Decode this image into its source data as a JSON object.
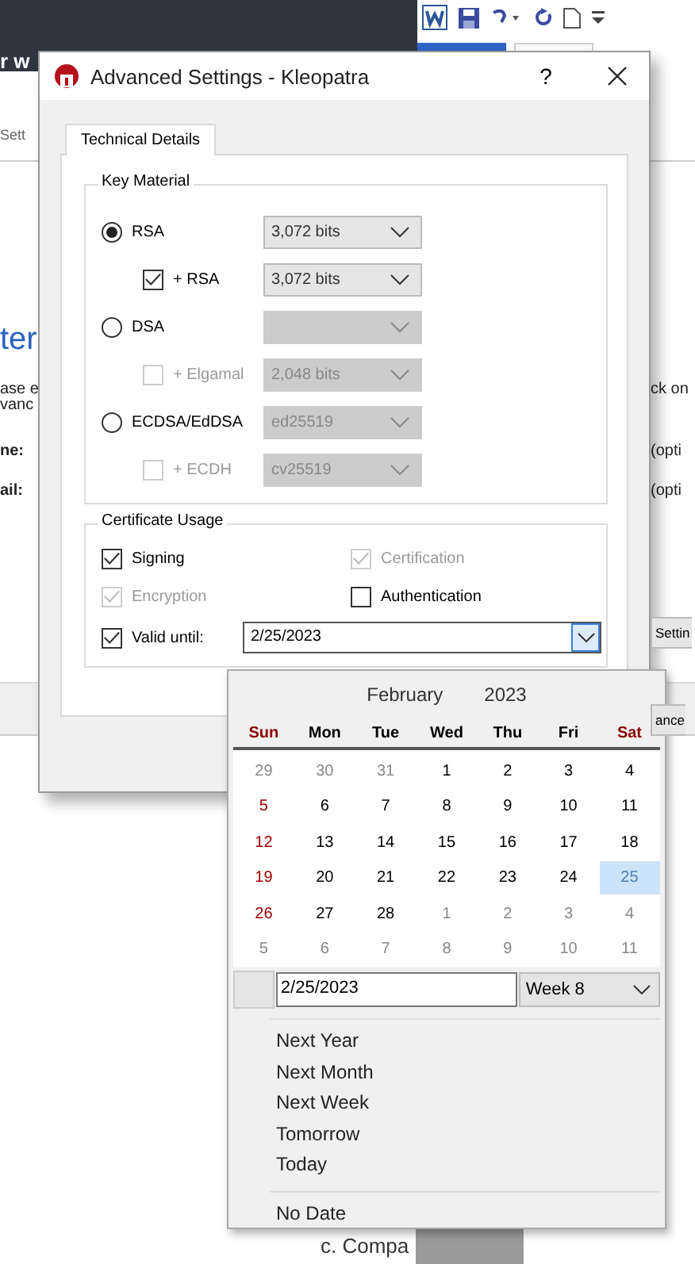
{
  "background": {
    "top_text": "r w",
    "left_fragments": [
      {
        "text": "Sett",
        "kind": "tab"
      },
      {
        "text": "ter",
        "kind": "heading"
      },
      {
        "text": "ase e",
        "kind": "text"
      },
      {
        "text": "vanc",
        "kind": "text"
      },
      {
        "text": "ne:",
        "kind": "label"
      },
      {
        "text": "ail:",
        "kind": "label"
      }
    ],
    "right_fragments": [
      {
        "text": "ck on",
        "kind": "text"
      },
      {
        "text": "(opti",
        "kind": "text"
      },
      {
        "text": "(opti",
        "kind": "text"
      },
      {
        "text": "Settin",
        "kind": "button"
      },
      {
        "text": "ance",
        "kind": "button"
      }
    ],
    "footer_text": "c. Compa"
  },
  "dialog": {
    "title": "Advanced Settings - Kleopatra",
    "help": "?"
  },
  "tabs": [
    {
      "label": "Technical Details",
      "selected": true
    }
  ],
  "key_material": {
    "title": "Key Material",
    "rows": [
      {
        "kind": "radio",
        "label": "RSA",
        "selected": true,
        "disabled": false,
        "combo_disabled": false,
        "value": "3,072 bits"
      },
      {
        "kind": "checkbox",
        "label": "+ RSA",
        "checked": true,
        "disabled": false,
        "combo_disabled": false,
        "value": "3,072 bits"
      },
      {
        "kind": "radio",
        "label": "DSA",
        "selected": false,
        "disabled": false,
        "combo_disabled": true
      },
      {
        "kind": "checkbox",
        "label": "+ Elgamal",
        "checked": false,
        "disabled": true,
        "combo_disabled": true,
        "value": "2,048 bits"
      },
      {
        "kind": "radio",
        "label": "ECDSA/EdDSA",
        "selected": false,
        "disabled": false,
        "combo_disabled": true,
        "value": "ed25519"
      },
      {
        "kind": "checkbox",
        "label": "+ ECDH",
        "checked": false,
        "disabled": true,
        "combo_disabled": true,
        "value": "cv25519"
      }
    ]
  },
  "certificate_usage": {
    "title": "Certificate Usage",
    "options": [
      {
        "label": "Signing",
        "checked": true,
        "disabled": false
      },
      {
        "label": "Certification",
        "checked": true,
        "disabled": true
      },
      {
        "label": "Encryption",
        "checked": true,
        "disabled": true
      },
      {
        "label": "Authentication",
        "checked": false,
        "disabled": false
      }
    ],
    "valid_until": {
      "label": "Valid until:",
      "checked": true,
      "value": "2/25/2023"
    }
  },
  "calendar": {
    "month": "February",
    "year": "2023",
    "weekdays": [
      {
        "label": "Sun",
        "red": true
      },
      {
        "label": "Mon",
        "red": false
      },
      {
        "label": "Tue",
        "red": false
      },
      {
        "label": "Wed",
        "red": false
      },
      {
        "label": "Thu",
        "red": false
      },
      {
        "label": "Fri",
        "red": false
      },
      {
        "label": "Sat",
        "red": true
      }
    ],
    "weeks": [
      [
        {
          "d": "29",
          "muted": true,
          "red": false,
          "selected": false
        },
        {
          "d": "30",
          "muted": true,
          "red": false,
          "selected": false
        },
        {
          "d": "31",
          "muted": true,
          "red": false,
          "selected": false
        },
        {
          "d": "1",
          "muted": false,
          "red": false,
          "selected": false
        },
        {
          "d": "2",
          "muted": false,
          "red": false,
          "selected": false
        },
        {
          "d": "3",
          "muted": false,
          "red": false,
          "selected": false
        },
        {
          "d": "4",
          "muted": false,
          "red": false,
          "selected": false
        }
      ],
      [
        {
          "d": "5",
          "muted": false,
          "red": true,
          "selected": false
        },
        {
          "d": "6",
          "muted": false,
          "red": false,
          "selected": false
        },
        {
          "d": "7",
          "muted": false,
          "red": false,
          "selected": false
        },
        {
          "d": "8",
          "muted": false,
          "red": false,
          "selected": false
        },
        {
          "d": "9",
          "muted": false,
          "red": false,
          "selected": false
        },
        {
          "d": "10",
          "muted": false,
          "red": false,
          "selected": false
        },
        {
          "d": "11",
          "muted": false,
          "red": false,
          "selected": false
        }
      ],
      [
        {
          "d": "12",
          "muted": false,
          "red": true,
          "selected": false
        },
        {
          "d": "13",
          "muted": false,
          "red": false,
          "selected": false
        },
        {
          "d": "14",
          "muted": false,
          "red": false,
          "selected": false
        },
        {
          "d": "15",
          "muted": false,
          "red": false,
          "selected": false
        },
        {
          "d": "16",
          "muted": false,
          "red": false,
          "selected": false
        },
        {
          "d": "17",
          "muted": false,
          "red": false,
          "selected": false
        },
        {
          "d": "18",
          "muted": false,
          "red": false,
          "selected": false
        }
      ],
      [
        {
          "d": "19",
          "muted": false,
          "red": true,
          "selected": false
        },
        {
          "d": "20",
          "muted": false,
          "red": false,
          "selected": false
        },
        {
          "d": "21",
          "muted": false,
          "red": false,
          "selected": false
        },
        {
          "d": "22",
          "muted": false,
          "red": false,
          "selected": false
        },
        {
          "d": "23",
          "muted": false,
          "red": false,
          "selected": false
        },
        {
          "d": "24",
          "muted": false,
          "red": false,
          "selected": false
        },
        {
          "d": "25",
          "muted": false,
          "red": false,
          "selected": true
        }
      ],
      [
        {
          "d": "26",
          "muted": false,
          "red": true,
          "selected": false
        },
        {
          "d": "27",
          "muted": false,
          "red": false,
          "selected": false
        },
        {
          "d": "28",
          "muted": false,
          "red": false,
          "selected": false
        },
        {
          "d": "1",
          "muted": true,
          "red": false,
          "selected": false
        },
        {
          "d": "2",
          "muted": true,
          "red": false,
          "selected": false
        },
        {
          "d": "3",
          "muted": true,
          "red": false,
          "selected": false
        },
        {
          "d": "4",
          "muted": true,
          "red": false,
          "selected": false
        }
      ],
      [
        {
          "d": "5",
          "muted": true,
          "red": false,
          "selected": false
        },
        {
          "d": "6",
          "muted": true,
          "red": false,
          "selected": false
        },
        {
          "d": "7",
          "muted": true,
          "red": false,
          "selected": false
        },
        {
          "d": "8",
          "muted": true,
          "red": false,
          "selected": false
        },
        {
          "d": "9",
          "muted": true,
          "red": false,
          "selected": false
        },
        {
          "d": "10",
          "muted": true,
          "red": false,
          "selected": false
        },
        {
          "d": "11",
          "muted": true,
          "red": false,
          "selected": false
        }
      ]
    ],
    "date_field": "2/25/2023",
    "week": "Week 8",
    "shortcuts": [
      "Next Year",
      "Next Month",
      "Next Week",
      "Tomorrow",
      "Today"
    ],
    "no_date": "No Date"
  }
}
